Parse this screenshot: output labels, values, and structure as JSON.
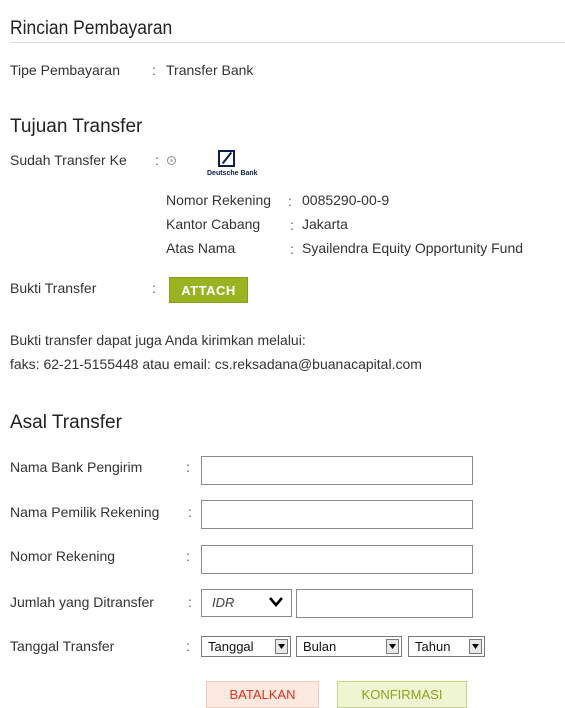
{
  "payment_details": {
    "title": "Rincian Pembayaran",
    "payment_type_label": "Tipe Pembayaran",
    "payment_type_value": "Transfer Bank"
  },
  "destination": {
    "title": "Tujuan Transfer",
    "transferred_to_label": "Sudah Transfer Ke",
    "bank_logo_text": "Deutsche Bank",
    "account_number_label": "Nomor Rekening",
    "account_number_value": "0085290-00-9",
    "branch_label": "Kantor Cabang",
    "branch_value": "Jakarta",
    "account_name_label": "Atas Nama",
    "account_name_value": "Syailendra Equity Opportunity Fund",
    "proof_label": "Bukti Transfer",
    "attach_label": "ATTACH",
    "note_line1": "Bukti transfer dapat juga Anda kirimkan melalui:",
    "note_line2": "faks: 62-21-5155448 atau email: cs.reksadana@buanacapital.com"
  },
  "origin": {
    "title": "Asal Transfer",
    "sender_bank_label": "Nama Bank Pengirim",
    "account_owner_label": "Nama Pemilik Rekening",
    "account_number_label": "Nomor Rekening",
    "amount_label": "Jumlah yang Ditransfer",
    "currency_value": "IDR",
    "date_label": "Tanggal Transfer",
    "day_select": "Tanggal",
    "month_select": "Bulan",
    "year_select": "Tahun"
  },
  "colon": ":",
  "actions": {
    "cancel_label": "BATALKAN",
    "confirm_label": "KONFIRMASI"
  }
}
